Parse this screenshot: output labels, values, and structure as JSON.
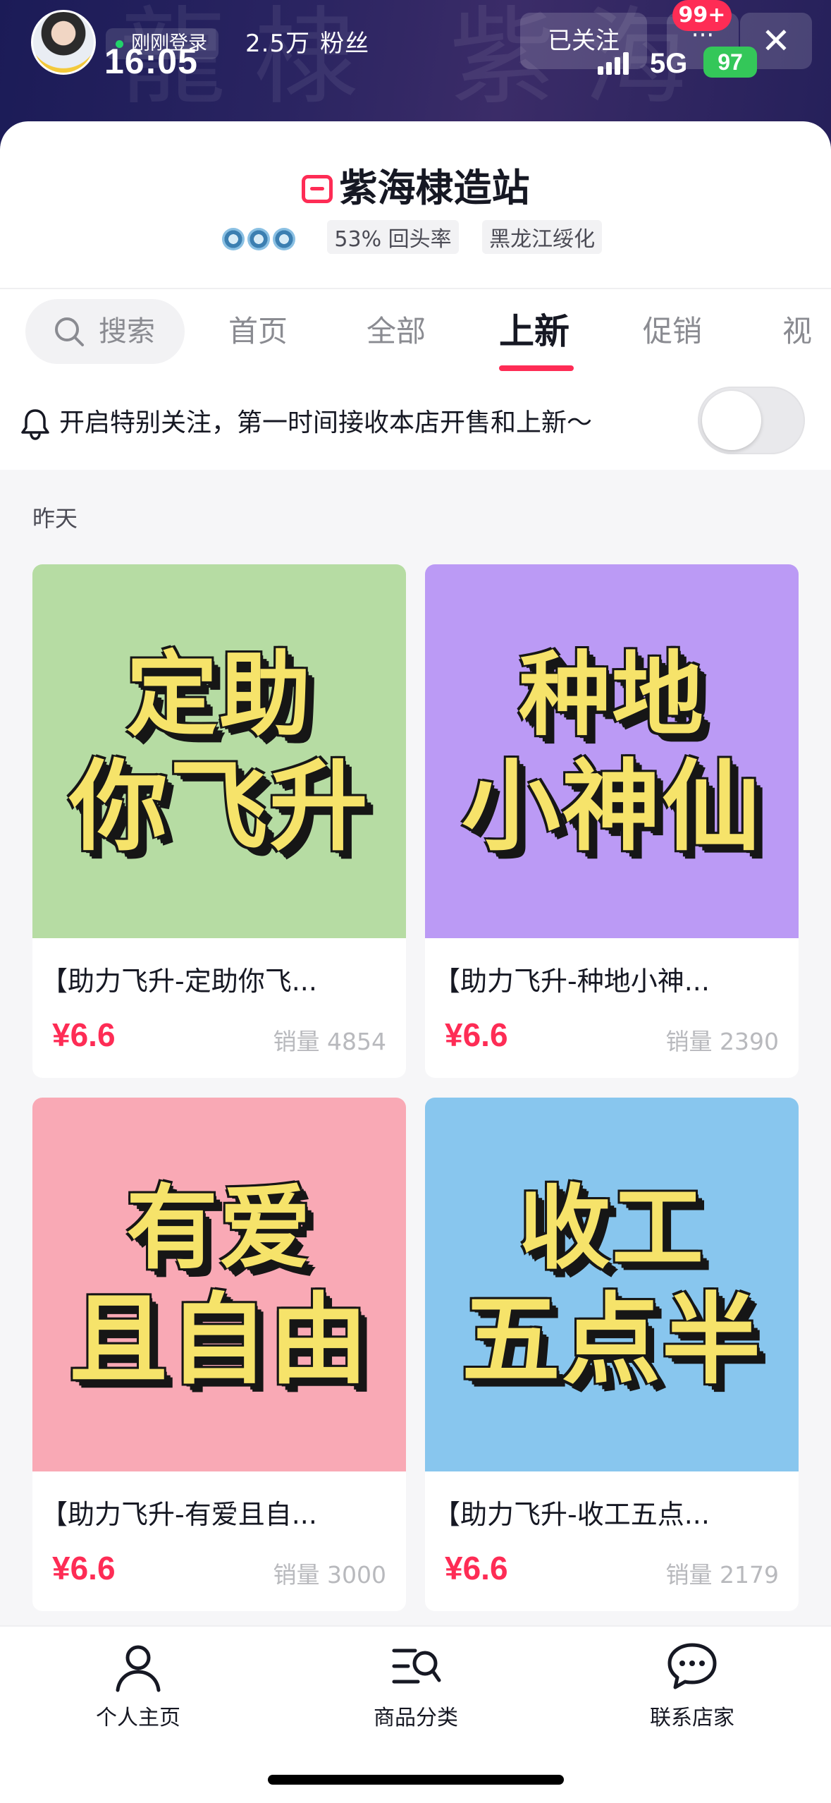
{
  "status_bar": {
    "time": "16:05",
    "network": "5G",
    "battery": "97"
  },
  "header": {
    "login_status": "刚刚登录",
    "fans_count": "2.5万",
    "fans_label": "粉丝",
    "follow_label": "已关注",
    "more_label": "···",
    "notification_badge": "99+",
    "close_label": "✕"
  },
  "store": {
    "name": "紫海棣造站",
    "return_rate": "53% 回头率",
    "location": "黑龙江绥化"
  },
  "tabs": {
    "search_label": "搜索",
    "items": [
      "首页",
      "全部",
      "上新",
      "促销",
      "视频"
    ],
    "active": "上新"
  },
  "notify": {
    "text": "开启特别关注，第一时间接收本店开售和上新～",
    "enabled": false
  },
  "feed": {
    "date_label": "昨天",
    "products": [
      {
        "poster_line1": "定助",
        "poster_line2": "你飞升",
        "bg_color": "#b6dca3",
        "title": "【助力飞升-定助你飞...",
        "price": "¥6.6",
        "sales": "销量 4854"
      },
      {
        "poster_line1": "种地",
        "poster_line2": "小神仙",
        "bg_color": "#bb9af5",
        "title": "【助力飞升-种地小神...",
        "price": "¥6.6",
        "sales": "销量 2390"
      },
      {
        "poster_line1": "有爱",
        "poster_line2": "且自由",
        "bg_color": "#f9a9b5",
        "title": "【助力飞升-有爱且自...",
        "price": "¥6.6",
        "sales": "销量 3000"
      },
      {
        "poster_line1": "收工",
        "poster_line2": "五点半",
        "bg_color": "#88c6ee",
        "title": "【助力飞升-收工五点...",
        "price": "¥6.6",
        "sales": "销量 2179"
      }
    ]
  },
  "bottom_nav": {
    "items": [
      {
        "label": "个人主页",
        "icon": "person-icon"
      },
      {
        "label": "商品分类",
        "icon": "category-search-icon"
      },
      {
        "label": "联系店家",
        "icon": "chat-bubble-icon"
      }
    ]
  },
  "colors": {
    "accent": "#fe2c55",
    "banner": "#2a2461",
    "price": "#fe2c55",
    "battery": "#34c759"
  }
}
